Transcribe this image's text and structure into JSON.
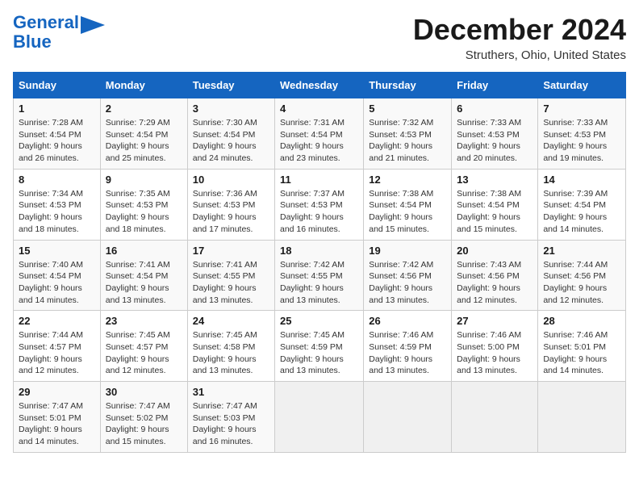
{
  "logo": {
    "line1": "General",
    "line2": "Blue",
    "icon_unicode": "▶"
  },
  "title": {
    "month_year": "December 2024",
    "location": "Struthers, Ohio, United States"
  },
  "calendar": {
    "headers": [
      "Sunday",
      "Monday",
      "Tuesday",
      "Wednesday",
      "Thursday",
      "Friday",
      "Saturday"
    ],
    "rows": [
      [
        {
          "day": "1",
          "sunrise": "Sunrise: 7:28 AM",
          "sunset": "Sunset: 4:54 PM",
          "daylight": "Daylight: 9 hours and 26 minutes."
        },
        {
          "day": "2",
          "sunrise": "Sunrise: 7:29 AM",
          "sunset": "Sunset: 4:54 PM",
          "daylight": "Daylight: 9 hours and 25 minutes."
        },
        {
          "day": "3",
          "sunrise": "Sunrise: 7:30 AM",
          "sunset": "Sunset: 4:54 PM",
          "daylight": "Daylight: 9 hours and 24 minutes."
        },
        {
          "day": "4",
          "sunrise": "Sunrise: 7:31 AM",
          "sunset": "Sunset: 4:54 PM",
          "daylight": "Daylight: 9 hours and 23 minutes."
        },
        {
          "day": "5",
          "sunrise": "Sunrise: 7:32 AM",
          "sunset": "Sunset: 4:53 PM",
          "daylight": "Daylight: 9 hours and 21 minutes."
        },
        {
          "day": "6",
          "sunrise": "Sunrise: 7:33 AM",
          "sunset": "Sunset: 4:53 PM",
          "daylight": "Daylight: 9 hours and 20 minutes."
        },
        {
          "day": "7",
          "sunrise": "Sunrise: 7:33 AM",
          "sunset": "Sunset: 4:53 PM",
          "daylight": "Daylight: 9 hours and 19 minutes."
        }
      ],
      [
        {
          "day": "8",
          "sunrise": "Sunrise: 7:34 AM",
          "sunset": "Sunset: 4:53 PM",
          "daylight": "Daylight: 9 hours and 18 minutes."
        },
        {
          "day": "9",
          "sunrise": "Sunrise: 7:35 AM",
          "sunset": "Sunset: 4:53 PM",
          "daylight": "Daylight: 9 hours and 18 minutes."
        },
        {
          "day": "10",
          "sunrise": "Sunrise: 7:36 AM",
          "sunset": "Sunset: 4:53 PM",
          "daylight": "Daylight: 9 hours and 17 minutes."
        },
        {
          "day": "11",
          "sunrise": "Sunrise: 7:37 AM",
          "sunset": "Sunset: 4:53 PM",
          "daylight": "Daylight: 9 hours and 16 minutes."
        },
        {
          "day": "12",
          "sunrise": "Sunrise: 7:38 AM",
          "sunset": "Sunset: 4:54 PM",
          "daylight": "Daylight: 9 hours and 15 minutes."
        },
        {
          "day": "13",
          "sunrise": "Sunrise: 7:38 AM",
          "sunset": "Sunset: 4:54 PM",
          "daylight": "Daylight: 9 hours and 15 minutes."
        },
        {
          "day": "14",
          "sunrise": "Sunrise: 7:39 AM",
          "sunset": "Sunset: 4:54 PM",
          "daylight": "Daylight: 9 hours and 14 minutes."
        }
      ],
      [
        {
          "day": "15",
          "sunrise": "Sunrise: 7:40 AM",
          "sunset": "Sunset: 4:54 PM",
          "daylight": "Daylight: 9 hours and 14 minutes."
        },
        {
          "day": "16",
          "sunrise": "Sunrise: 7:41 AM",
          "sunset": "Sunset: 4:54 PM",
          "daylight": "Daylight: 9 hours and 13 minutes."
        },
        {
          "day": "17",
          "sunrise": "Sunrise: 7:41 AM",
          "sunset": "Sunset: 4:55 PM",
          "daylight": "Daylight: 9 hours and 13 minutes."
        },
        {
          "day": "18",
          "sunrise": "Sunrise: 7:42 AM",
          "sunset": "Sunset: 4:55 PM",
          "daylight": "Daylight: 9 hours and 13 minutes."
        },
        {
          "day": "19",
          "sunrise": "Sunrise: 7:42 AM",
          "sunset": "Sunset: 4:56 PM",
          "daylight": "Daylight: 9 hours and 13 minutes."
        },
        {
          "day": "20",
          "sunrise": "Sunrise: 7:43 AM",
          "sunset": "Sunset: 4:56 PM",
          "daylight": "Daylight: 9 hours and 12 minutes."
        },
        {
          "day": "21",
          "sunrise": "Sunrise: 7:44 AM",
          "sunset": "Sunset: 4:56 PM",
          "daylight": "Daylight: 9 hours and 12 minutes."
        }
      ],
      [
        {
          "day": "22",
          "sunrise": "Sunrise: 7:44 AM",
          "sunset": "Sunset: 4:57 PM",
          "daylight": "Daylight: 9 hours and 12 minutes."
        },
        {
          "day": "23",
          "sunrise": "Sunrise: 7:45 AM",
          "sunset": "Sunset: 4:57 PM",
          "daylight": "Daylight: 9 hours and 12 minutes."
        },
        {
          "day": "24",
          "sunrise": "Sunrise: 7:45 AM",
          "sunset": "Sunset: 4:58 PM",
          "daylight": "Daylight: 9 hours and 13 minutes."
        },
        {
          "day": "25",
          "sunrise": "Sunrise: 7:45 AM",
          "sunset": "Sunset: 4:59 PM",
          "daylight": "Daylight: 9 hours and 13 minutes."
        },
        {
          "day": "26",
          "sunrise": "Sunrise: 7:46 AM",
          "sunset": "Sunset: 4:59 PM",
          "daylight": "Daylight: 9 hours and 13 minutes."
        },
        {
          "day": "27",
          "sunrise": "Sunrise: 7:46 AM",
          "sunset": "Sunset: 5:00 PM",
          "daylight": "Daylight: 9 hours and 13 minutes."
        },
        {
          "day": "28",
          "sunrise": "Sunrise: 7:46 AM",
          "sunset": "Sunset: 5:01 PM",
          "daylight": "Daylight: 9 hours and 14 minutes."
        }
      ],
      [
        {
          "day": "29",
          "sunrise": "Sunrise: 7:47 AM",
          "sunset": "Sunset: 5:01 PM",
          "daylight": "Daylight: 9 hours and 14 minutes."
        },
        {
          "day": "30",
          "sunrise": "Sunrise: 7:47 AM",
          "sunset": "Sunset: 5:02 PM",
          "daylight": "Daylight: 9 hours and 15 minutes."
        },
        {
          "day": "31",
          "sunrise": "Sunrise: 7:47 AM",
          "sunset": "Sunset: 5:03 PM",
          "daylight": "Daylight: 9 hours and 16 minutes."
        },
        null,
        null,
        null,
        null
      ]
    ]
  }
}
